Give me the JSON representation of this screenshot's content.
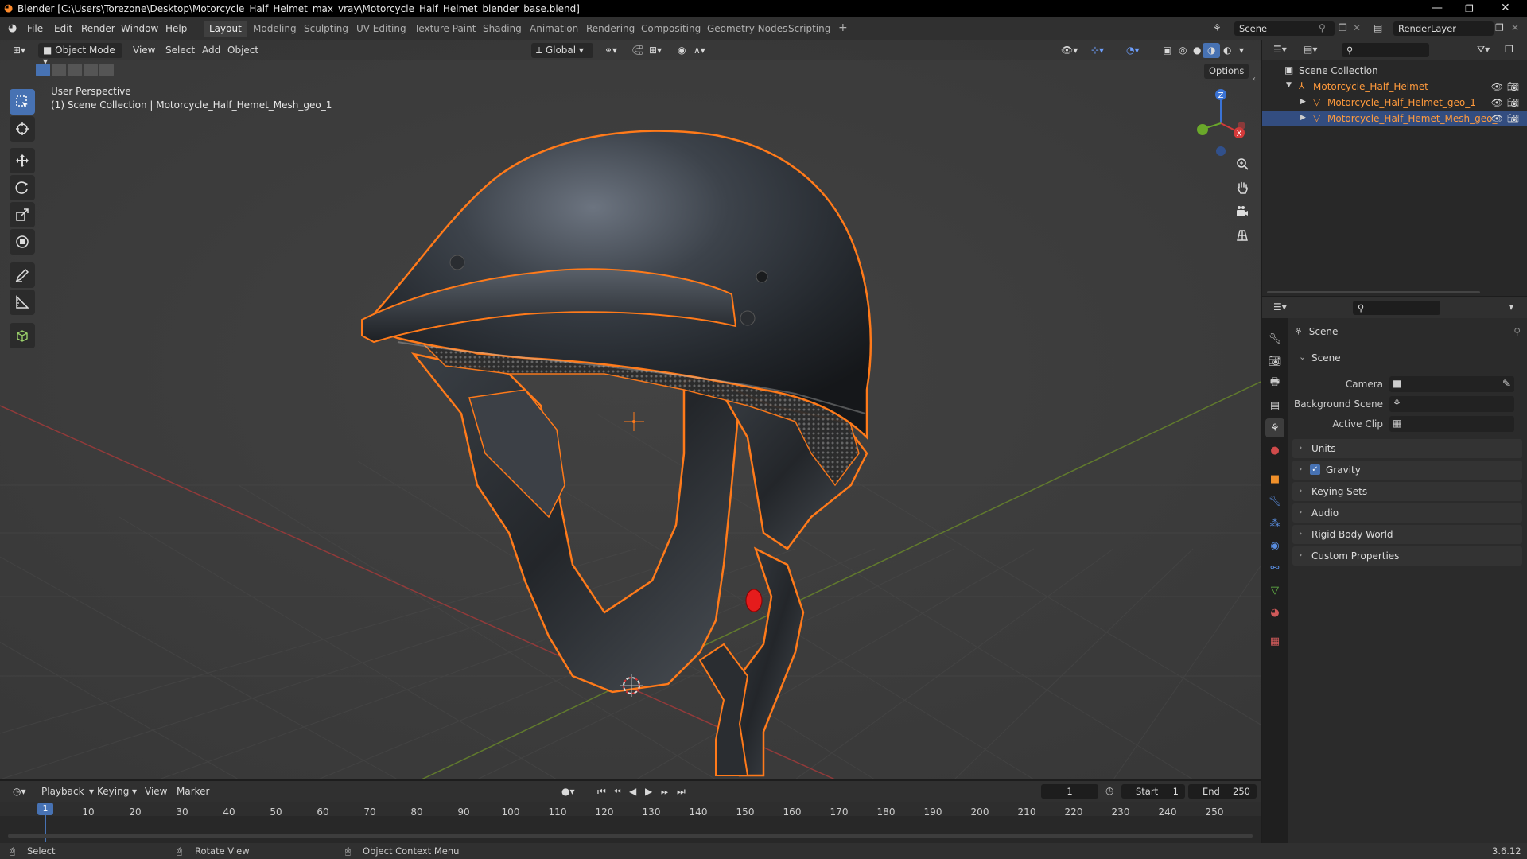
{
  "window": {
    "title": "Blender [C:\\Users\\Torezone\\Desktop\\Motorcycle_Half_Helmet_max_vray\\Motorcycle_Half_Helmet_blender_base.blend]",
    "controls": [
      "—",
      "❐",
      "✕"
    ]
  },
  "menu": [
    "File",
    "Edit",
    "Render",
    "Window",
    "Help"
  ],
  "workspaces": [
    "Layout",
    "Modeling",
    "Sculpting",
    "UV Editing",
    "Texture Paint",
    "Shading",
    "Animation",
    "Rendering",
    "Compositing",
    "Geometry Nodes",
    "Scripting"
  ],
  "workspace_add": "+",
  "scene_field": "Scene",
  "renderlayer_field": "RenderLayer",
  "viewport": {
    "mode": "Object Mode",
    "menus": [
      "View",
      "Select",
      "Add",
      "Object"
    ],
    "orientation": "Global",
    "options": "Options",
    "info_line1": "User Perspective",
    "info_line2": "(1) Scene Collection | Motorcycle_Half_Hemet_Mesh_geo_1",
    "gizmo_z": "Z",
    "gizmo_x": "X"
  },
  "outliner": {
    "root": "Scene Collection",
    "items": [
      {
        "name": "Motorcycle_Half_Helmet",
        "indent": 0
      },
      {
        "name": "Motorcycle_Half_Helmet_geo_1",
        "indent": 1
      },
      {
        "name": "Motorcycle_Half_Hemet_Mesh_geo_",
        "indent": 1
      }
    ]
  },
  "properties": {
    "context": "Scene",
    "panel": "Scene",
    "fields": [
      {
        "label": "Camera"
      },
      {
        "label": "Background Scene"
      },
      {
        "label": "Active Clip"
      }
    ],
    "sections": [
      "Units",
      "Gravity",
      "Keying Sets",
      "Audio",
      "Rigid Body World",
      "Custom Properties"
    ],
    "gravity_checked": true
  },
  "timeline": {
    "menus": [
      "Playback",
      "Keying",
      "View",
      "Marker"
    ],
    "current_frame": "1",
    "start_label": "Start",
    "start_value": "1",
    "end_label": "End",
    "end_value": "250",
    "ticks": [
      "1",
      "10",
      "20",
      "30",
      "40",
      "50",
      "60",
      "70",
      "80",
      "90",
      "100",
      "110",
      "120",
      "130",
      "140",
      "150",
      "160",
      "170",
      "180",
      "190",
      "200",
      "210",
      "220",
      "230",
      "240",
      "250"
    ]
  },
  "status": {
    "select": "Select",
    "rotate": "Rotate View",
    "context": "Object Context Menu",
    "version": "3.6.12"
  },
  "colors": {
    "accent": "#4772b3",
    "selection_outline": "#ff7a1a",
    "selected_row": "#334d80",
    "frame_indicator": "#4772b3"
  }
}
